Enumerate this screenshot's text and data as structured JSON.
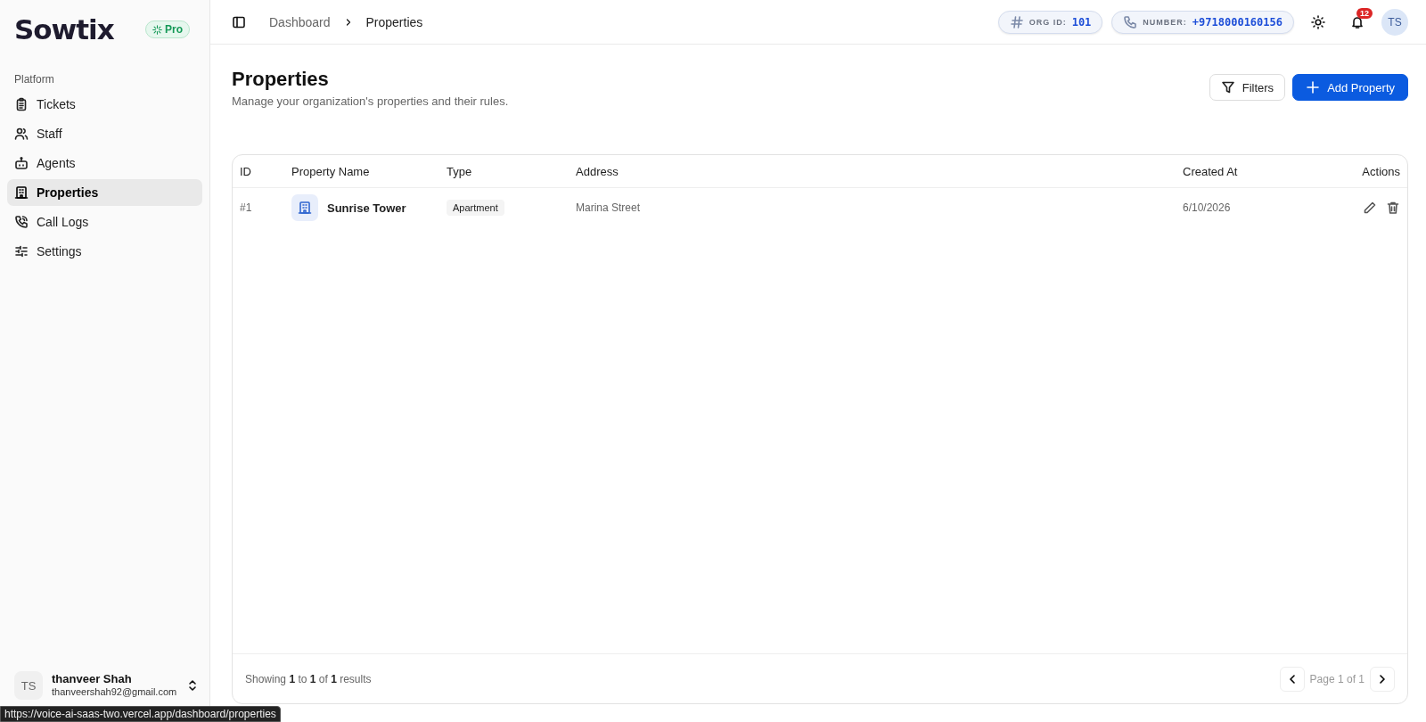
{
  "sidebar": {
    "logo": "Sowtix",
    "plan_badge": "Pro",
    "section_label": "Platform",
    "items": [
      {
        "label": "Tickets",
        "selected": false
      },
      {
        "label": "Staff",
        "selected": false
      },
      {
        "label": "Agents",
        "selected": false
      },
      {
        "label": "Properties",
        "selected": true
      },
      {
        "label": "Call Logs",
        "selected": false
      },
      {
        "label": "Settings",
        "selected": false
      }
    ],
    "user": {
      "initials": "TS",
      "name": "thanveer Shah",
      "email": "thanveershah92@gmail.com"
    }
  },
  "header": {
    "breadcrumbs": [
      "Dashboard",
      "Properties"
    ],
    "org_id": {
      "label": "ORG ID:",
      "value": "101"
    },
    "number": {
      "label": "NUMBER:",
      "value": "+9718000160156"
    },
    "notification_count": "12",
    "avatar": "TS"
  },
  "page": {
    "title": "Properties",
    "subtitle": "Manage your organization's properties and their rules.",
    "buttons": [
      {
        "label": "Filters",
        "kind": "outline"
      },
      {
        "label": "Add Property",
        "kind": "primary"
      }
    ]
  },
  "table": {
    "columns": [
      "ID",
      "Property Name",
      "Type",
      "Address",
      "Created At",
      "Actions"
    ],
    "rows": [
      {
        "id": "#1",
        "name": "Sunrise Tower",
        "type": "Apartment",
        "address": "Marina Street",
        "created_at": "6/10/2026"
      }
    ],
    "footer": {
      "summary": "Showing **1** to **1** of **1** results",
      "page": "Page 1 of 1"
    }
  },
  "status_url": "https://voice-ai-saas-two.vercel.app/dashboard/properties"
}
